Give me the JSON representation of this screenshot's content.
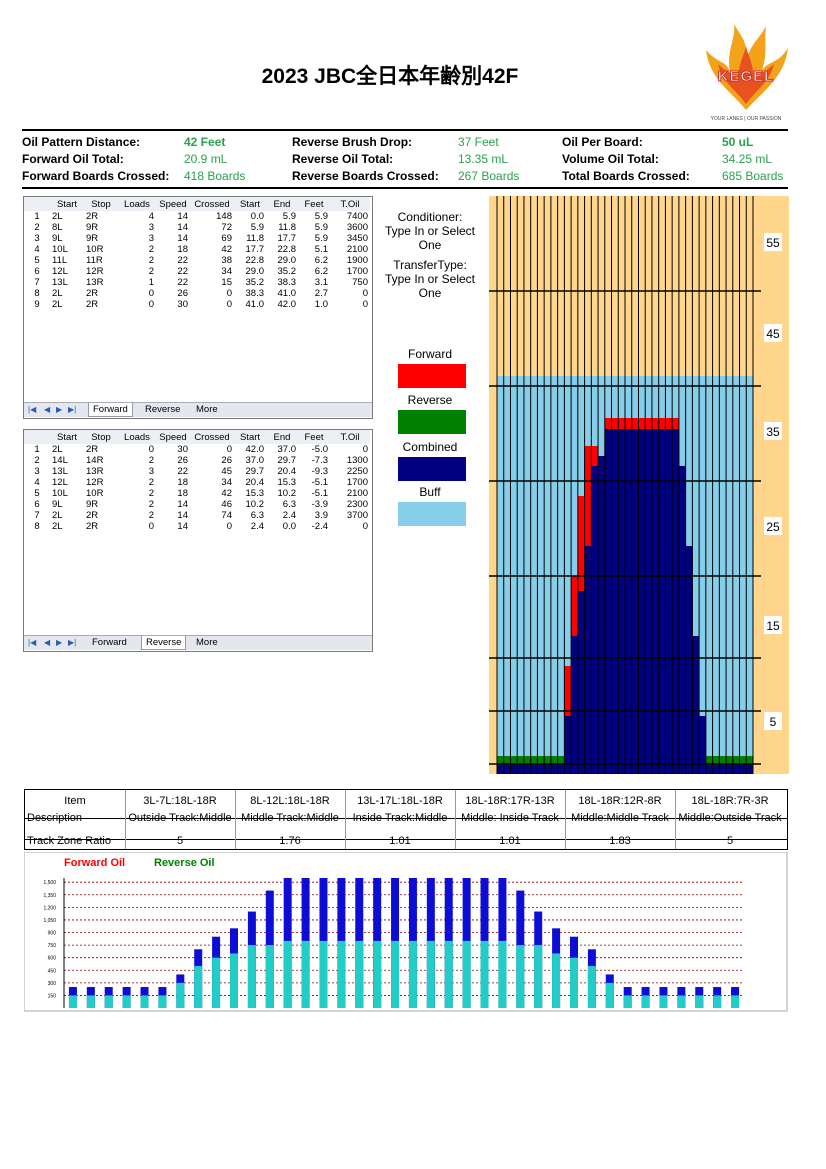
{
  "title": "2023 JBC全日本年齢別42F",
  "logo": {
    "name": "KEGEL",
    "tagline": "YOUR LANES | OUR PASSION",
    "colors": {
      "flame": "#e8521e",
      "gold": "#f2a31a"
    }
  },
  "summary": [
    {
      "label": "Oil Pattern Distance:",
      "value": "42 Feet",
      "bold": true
    },
    {
      "label": "Forward Oil Total:",
      "value": "20.9 mL",
      "bold": false
    },
    {
      "label": "Forward Boards Crossed:",
      "value": "418 Boards",
      "bold": false
    },
    {
      "label": "Reverse Brush Drop:",
      "value": "37 Feet",
      "bold": false
    },
    {
      "label": "Reverse Oil Total:",
      "value": "13.35 mL",
      "bold": false
    },
    {
      "label": "Reverse Boards Crossed:",
      "value": "267 Boards",
      "bold": false
    },
    {
      "label": "Oil Per Board:",
      "value": "50 uL",
      "bold": true
    },
    {
      "label": "Volume Oil Total:",
      "value": "34.25 mL",
      "bold": false
    },
    {
      "label": "Total Boards Crossed:",
      "value": "685 Boards",
      "bold": false
    }
  ],
  "forward_table": {
    "headers": [
      "",
      "Start",
      "Stop",
      "Loads",
      "Speed",
      "Crossed",
      "Start",
      "End",
      "Feet",
      "T.Oil"
    ],
    "rows": [
      [
        "1",
        "2L",
        "2R",
        "4",
        "14",
        "148",
        "0.0",
        "5.9",
        "5.9",
        "7400"
      ],
      [
        "2",
        "8L",
        "9R",
        "3",
        "14",
        "72",
        "5.9",
        "11.8",
        "5.9",
        "3600"
      ],
      [
        "3",
        "9L",
        "9R",
        "3",
        "14",
        "69",
        "11.8",
        "17.7",
        "5.9",
        "3450"
      ],
      [
        "4",
        "10L",
        "10R",
        "2",
        "18",
        "42",
        "17.7",
        "22.8",
        "5.1",
        "2100"
      ],
      [
        "5",
        "11L",
        "11R",
        "2",
        "22",
        "38",
        "22.8",
        "29.0",
        "6.2",
        "1900"
      ],
      [
        "6",
        "12L",
        "12R",
        "2",
        "22",
        "34",
        "29.0",
        "35.2",
        "6.2",
        "1700"
      ],
      [
        "7",
        "13L",
        "13R",
        "1",
        "22",
        "15",
        "35.2",
        "38.3",
        "3.1",
        "750"
      ],
      [
        "8",
        "2L",
        "2R",
        "0",
        "26",
        "0",
        "38.3",
        "41.0",
        "2.7",
        "0"
      ],
      [
        "9",
        "2L",
        "2R",
        "0",
        "30",
        "0",
        "41.0",
        "42.0",
        "1.0",
        "0"
      ]
    ],
    "tabs": [
      "Forward",
      "Reverse",
      "More"
    ],
    "active_tab": 0
  },
  "reverse_table": {
    "headers": [
      "",
      "Start",
      "Stop",
      "Loads",
      "Speed",
      "Crossed",
      "Start",
      "End",
      "Feet",
      "T.Oil"
    ],
    "rows": [
      [
        "1",
        "2L",
        "2R",
        "0",
        "30",
        "0",
        "42.0",
        "37.0",
        "-5.0",
        "0"
      ],
      [
        "2",
        "14L",
        "14R",
        "2",
        "26",
        "26",
        "37.0",
        "29.7",
        "-7.3",
        "1300"
      ],
      [
        "3",
        "13L",
        "13R",
        "3",
        "22",
        "45",
        "29.7",
        "20.4",
        "-9.3",
        "2250"
      ],
      [
        "4",
        "12L",
        "12R",
        "2",
        "18",
        "34",
        "20.4",
        "15.3",
        "-5.1",
        "1700"
      ],
      [
        "5",
        "10L",
        "10R",
        "2",
        "18",
        "42",
        "15.3",
        "10.2",
        "-5.1",
        "2100"
      ],
      [
        "6",
        "9L",
        "9R",
        "2",
        "14",
        "46",
        "10.2",
        "6.3",
        "-3.9",
        "2300"
      ],
      [
        "7",
        "2L",
        "2R",
        "2",
        "14",
        "74",
        "6.3",
        "2.4",
        "3.9",
        "3700"
      ],
      [
        "8",
        "2L",
        "2R",
        "0",
        "14",
        "0",
        "2.4",
        "0.0",
        "-2.4",
        "0"
      ]
    ],
    "tabs": [
      "Forward",
      "Reverse",
      "More"
    ],
    "active_tab": 1
  },
  "conditioner": {
    "label1": "Conditioner:",
    "label2": "Type In or Select One"
  },
  "transfer": {
    "label1": "TransferType:",
    "label2": "Type In or Select One"
  },
  "legend": [
    {
      "label": "Forward",
      "color": "#ff0000"
    },
    {
      "label": "Reverse",
      "color": "#008000"
    },
    {
      "label": "Combined",
      "color": "#000080"
    },
    {
      "label": "Buff",
      "color": "#87ceeb"
    }
  ],
  "lane_chart": {
    "ruler_labels": [
      "55",
      "45",
      "35",
      "25",
      "15",
      "5"
    ],
    "colors": {
      "dry": "#ffd68c",
      "buff": "#87ceeb",
      "forward": "#ff0000",
      "reverse": "#008000",
      "combined": "#000080",
      "ruler": "#ffd68c"
    }
  },
  "zone_table": {
    "item_label": "Item",
    "desc_label": "Description",
    "ratio_label": "Track Zone Ratio",
    "zones": [
      {
        "range": "3L-7L:18L-18R",
        "desc": "Outside Track:Middle",
        "ratio": "5"
      },
      {
        "range": "8L-12L:18L-18R",
        "desc": "Middle Track:Middle",
        "ratio": "1.76"
      },
      {
        "range": "13L-17L:18L-18R",
        "desc": "Inside Track:Middle",
        "ratio": "1.01"
      },
      {
        "range": "18L-18R:17R-13R",
        "desc": "Middle: Inside Track",
        "ratio": "1.01"
      },
      {
        "range": "18L-18R:12R-8R",
        "desc": "Middle:Middle Track",
        "ratio": "1.83"
      },
      {
        "range": "18L-18R:7R-3R",
        "desc": "Middle:Outside Track",
        "ratio": "5"
      }
    ]
  },
  "chart_data": {
    "type": "bar",
    "legend": [
      {
        "name": "Forward Oil",
        "color": "#ff0000"
      },
      {
        "name": "Reverse Oil",
        "color": "#008000"
      }
    ],
    "ylim": [
      0,
      1550
    ],
    "y_ticks": [
      "1,500",
      "1,350",
      "1,200",
      "1,050",
      "900",
      "750",
      "600",
      "450",
      "300",
      "150"
    ],
    "series": [
      {
        "name": "Forward Oil",
        "color": "#0d0dd6",
        "values": [
          250,
          250,
          250,
          250,
          250,
          250,
          400,
          700,
          850,
          950,
          1150,
          1400,
          1550,
          1550,
          1550,
          1550,
          1550,
          1550,
          1550,
          1550,
          1550,
          1550,
          1550,
          1550,
          1550,
          1400,
          1150,
          950,
          850,
          700,
          400,
          250,
          250,
          250,
          250,
          250,
          250,
          250
        ]
      },
      {
        "name": "Reverse Oil",
        "color": "#22cdc8",
        "values": [
          150,
          150,
          150,
          150,
          150,
          150,
          300,
          500,
          600,
          650,
          750,
          750,
          800,
          800,
          800,
          800,
          800,
          800,
          800,
          800,
          800,
          800,
          800,
          800,
          800,
          750,
          750,
          650,
          600,
          500,
          300,
          150,
          150,
          150,
          150,
          150,
          150,
          150
        ]
      }
    ]
  }
}
